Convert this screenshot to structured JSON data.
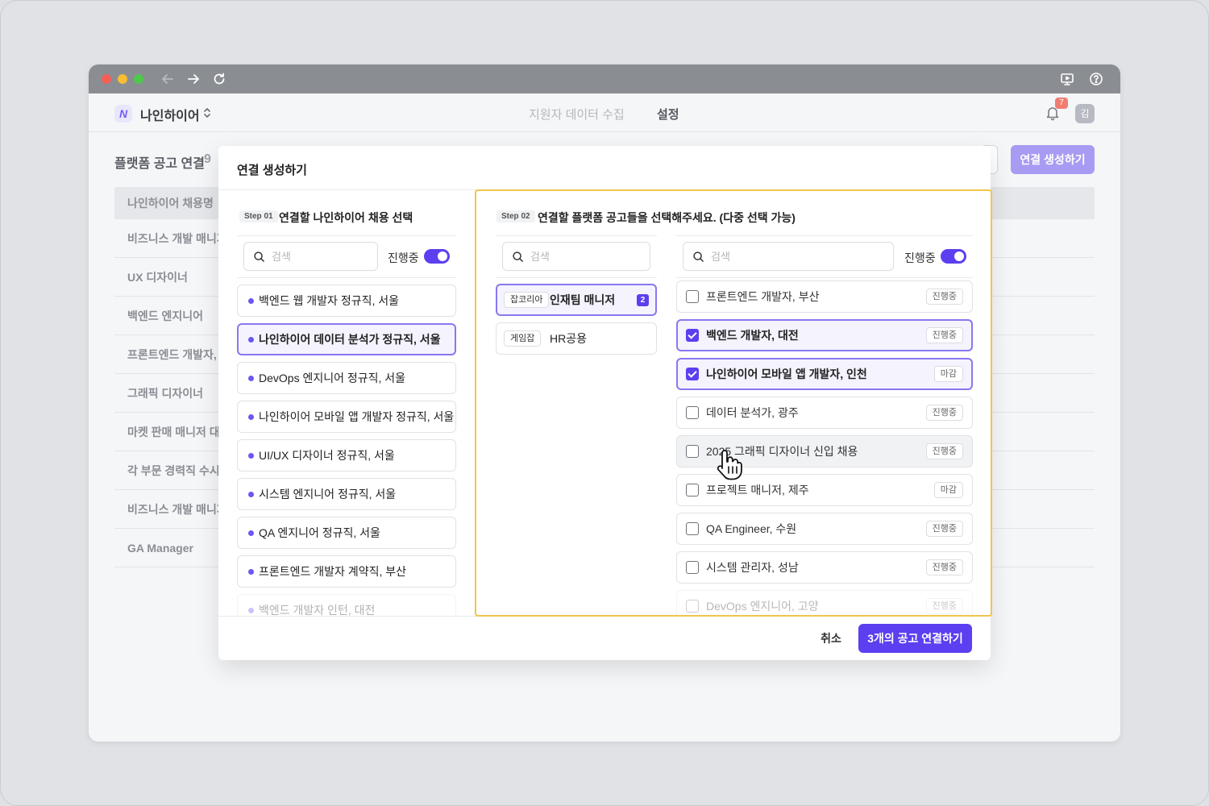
{
  "browser": {
    "back_icon": "arrow-left-icon",
    "forward_icon": "arrow-right-icon",
    "reload_icon": "reload-icon"
  },
  "header": {
    "org_name": "나인하이어",
    "nav": [
      "지원자 데이터 수집",
      "설정"
    ],
    "active_nav": "설정",
    "notification_count": "7",
    "avatar_initial": "김"
  },
  "page": {
    "title": "플랫폼 공고 연결",
    "count": "9",
    "create_button": "연결 생성하기",
    "table_header": "나인하이어 채용명",
    "rows": [
      "비즈니스 개발 매니저",
      "UX 디자이너",
      "백엔드 엔지니어",
      "프론트엔드 개발자, 경",
      "그래픽 디자이너",
      "마켓 판매 매니저 대구",
      "각 부문 경력직 수시채",
      "비즈니스 개발 매니저",
      "GA Manager"
    ]
  },
  "modal": {
    "title": "연결 생성하기",
    "step1": {
      "tag": "Step 01",
      "title": "연결할 나인하이어 채용 선택",
      "search_placeholder": "검색",
      "toggle_label": "진행중",
      "items": [
        {
          "label": "백엔드 웹 개발자 정규직, 서울",
          "selected": false
        },
        {
          "label": "나인하이어 데이터 분석가 정규직, 서울",
          "selected": true
        },
        {
          "label": "DevOps 엔지니어 정규직, 서울",
          "selected": false
        },
        {
          "label": "나인하이어 모바일 앱 개발자 정규직, 서울",
          "selected": false
        },
        {
          "label": "UI/UX 디자이너 정규직, 서울",
          "selected": false
        },
        {
          "label": "시스템 엔지니어 정규직, 서울",
          "selected": false
        },
        {
          "label": "QA 엔지니어 정규직, 서울",
          "selected": false
        },
        {
          "label": "프론트엔드 개발자 계약직, 부산",
          "selected": false
        },
        {
          "label": "백엔드 개발자 인턴, 대전",
          "selected": false
        }
      ]
    },
    "step2": {
      "tag": "Step 02",
      "title": "연결할 플랫폼 공고들을 선택해주세요. (다중 선택 가능)",
      "platform_search_placeholder": "검색",
      "posting_search_placeholder": "검색",
      "toggle_label": "진행중",
      "platforms": [
        {
          "tag": "잡코리아",
          "name": "인재팀 매니저",
          "count": "2",
          "selected": true
        },
        {
          "tag": "게임잡",
          "name": "HR공용",
          "count": "",
          "selected": false
        }
      ],
      "postings": [
        {
          "label": "프론트엔드 개발자, 부산",
          "status": "진행중",
          "checked": false
        },
        {
          "label": "백엔드 개발자, 대전",
          "status": "진행중",
          "checked": true
        },
        {
          "label": "나인하이어 모바일 앱 개발자, 인천",
          "status": "마감",
          "checked": true
        },
        {
          "label": "데이터 분석가, 광주",
          "status": "진행중",
          "checked": false
        },
        {
          "label": "2025 그래픽 디자이너 신입 채용",
          "status": "진행중",
          "checked": false
        },
        {
          "label": "프로젝트 매니저, 제주",
          "status": "마감",
          "checked": false
        },
        {
          "label": "QA Engineer, 수원",
          "status": "진행중",
          "checked": false
        },
        {
          "label": "시스템 관리자, 성남",
          "status": "진행중",
          "checked": false
        },
        {
          "label": "DevOps 엔지니어, 고양",
          "status": "진행중",
          "checked": false
        }
      ]
    },
    "cancel_button": "취소",
    "confirm_button": "3개의 공고 연결하기"
  },
  "colors": {
    "accent": "#5b3ff0",
    "accent_light": "#a89bf3",
    "highlight_border": "#f1c54a"
  }
}
